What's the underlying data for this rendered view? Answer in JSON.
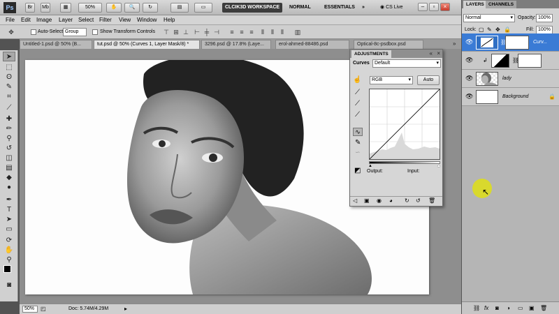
{
  "app": {
    "logo": "Ps",
    "zoom_button": "50%",
    "workspaces": [
      "CLCIK3D WORKSPACE",
      "NORMAL",
      "ESSENTIALS"
    ],
    "overflow": "»",
    "cslive": "CS Live"
  },
  "menubar": [
    "File",
    "Edit",
    "Image",
    "Layer",
    "Select",
    "Filter",
    "View",
    "Window",
    "Help"
  ],
  "options": {
    "auto_select_label": "Auto-Select:",
    "auto_select_value": "Group",
    "show_transform": "Show Transform Controls"
  },
  "tabs": [
    "Untitled-1.psd @ 50% (B...",
    "tut.psd @ 50% (Curves 1, Layer Mask/8) *",
    "3296.psd @ 17.8% (Laye...",
    "erol-ahmed-88486.psd",
    "Optical-8c-psdbox.psd"
  ],
  "status": {
    "zoom": "50%",
    "doc": "Doc: 5.74M/4.29M"
  },
  "adjustments": {
    "tab": "ADJUSTMENTS",
    "title": "Curves",
    "preset": "Default",
    "channel": "RGB",
    "auto": "Auto",
    "output_label": "Output:",
    "input_label": "Input:"
  },
  "layers": {
    "tabs": [
      "LAYERS",
      "CHANNELS"
    ],
    "blend_mode": "Normal",
    "opacity_label": "Opacity:",
    "opacity_value": "100%",
    "lock_label": "Lock:",
    "fill_label": "Fill:",
    "fill_value": "100%",
    "rows": [
      {
        "name": "Curv...",
        "selected": true
      },
      {
        "name": "",
        "selected": false
      },
      {
        "name": "lady",
        "selected": false
      },
      {
        "name": "Background",
        "selected": false
      }
    ]
  },
  "colors": {
    "accent": "#3a7bd5",
    "panel_bg": "#d6d6d6",
    "cursor": "#e6e600"
  }
}
